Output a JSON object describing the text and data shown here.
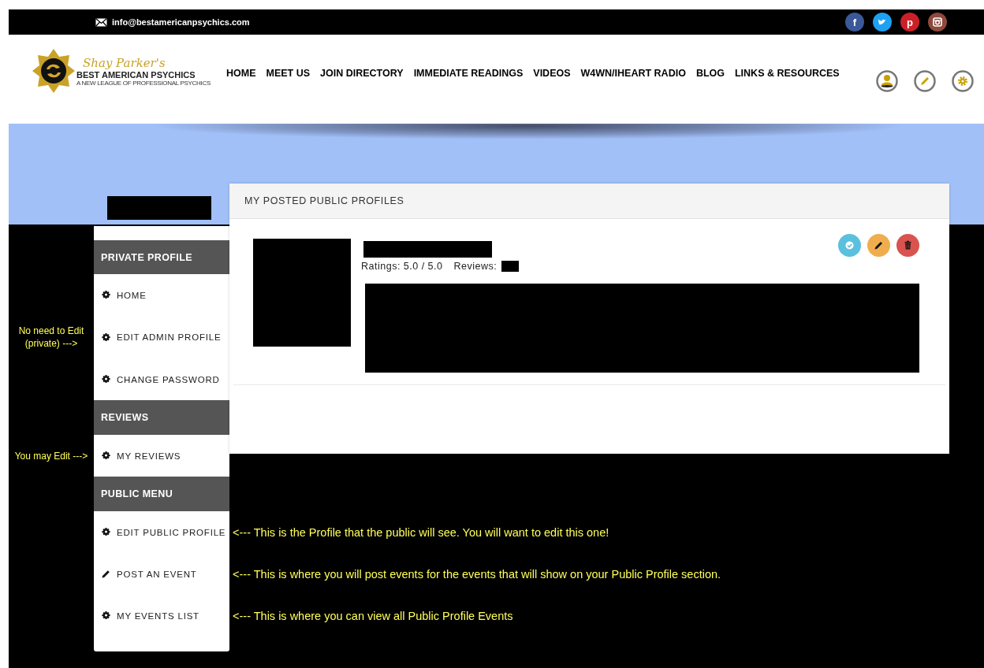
{
  "top_bar": {
    "email": "info@bestamericanpsychics.com",
    "social": [
      {
        "kind": "letter",
        "label": "f",
        "color": "#3b5998"
      },
      {
        "kind": "bird",
        "color": "#1da1f2"
      },
      {
        "kind": "letter",
        "label": "p",
        "color": "#cb2027"
      },
      {
        "kind": "camera",
        "color": "#8e4a3c"
      }
    ]
  },
  "header": {
    "logo": {
      "script": "Shay Parker's",
      "name": "BEST AMERICAN PSYCHICS",
      "tagline": "A NEW LEAGUE OF PROFESSIONAL PSYCHICS"
    },
    "nav": [
      "HOME",
      "MEET US",
      "JOIN DIRECTORY",
      "IMMEDIATE READINGS",
      "VIDEOS",
      "W4WN/IHEART RADIO",
      "BLOG",
      "LINKS & RESOURCES"
    ]
  },
  "sidebar": {
    "sections": [
      {
        "title": "PRIVATE PROFILE",
        "items": [
          {
            "label": "HOME",
            "kind": "link"
          },
          {
            "label": "EDIT ADMIN PROFILE",
            "kind": "link",
            "note_left": "No need to Edit (private) --->"
          },
          {
            "label": "CHANGE PASSWORD",
            "kind": "link"
          }
        ]
      },
      {
        "title": "REVIEWS",
        "items": [
          {
            "label": "MY REVIEWS",
            "kind": "link",
            "note_left": "You may Edit --->"
          }
        ]
      },
      {
        "title": "PUBLIC MENU",
        "items": [
          {
            "label": "EDIT PUBLIC PROFILE",
            "kind": "link",
            "note_right": "<--- This is the Profile that the public will see.  You will want to edit this one!"
          },
          {
            "label": "POST AN EVENT",
            "kind": "compose",
            "note_right": "<--- This is where you will post events for the events that will show on your Public Profile section."
          },
          {
            "label": "MY EVENTS LIST",
            "kind": "link",
            "note_right": "<--- This is where you can view all Public Profile Events"
          }
        ]
      }
    ]
  },
  "card": {
    "title": "MY POSTED PUBLIC PROFILES",
    "ratings": "Ratings: 5.0 / 5.0",
    "reviews_label": "Reviews:",
    "actions": [
      {
        "kind": "approve",
        "color": "#5bc0de"
      },
      {
        "kind": "edit",
        "color": "#f0ad4e"
      },
      {
        "kind": "delete",
        "color": "#d9534f"
      }
    ]
  }
}
